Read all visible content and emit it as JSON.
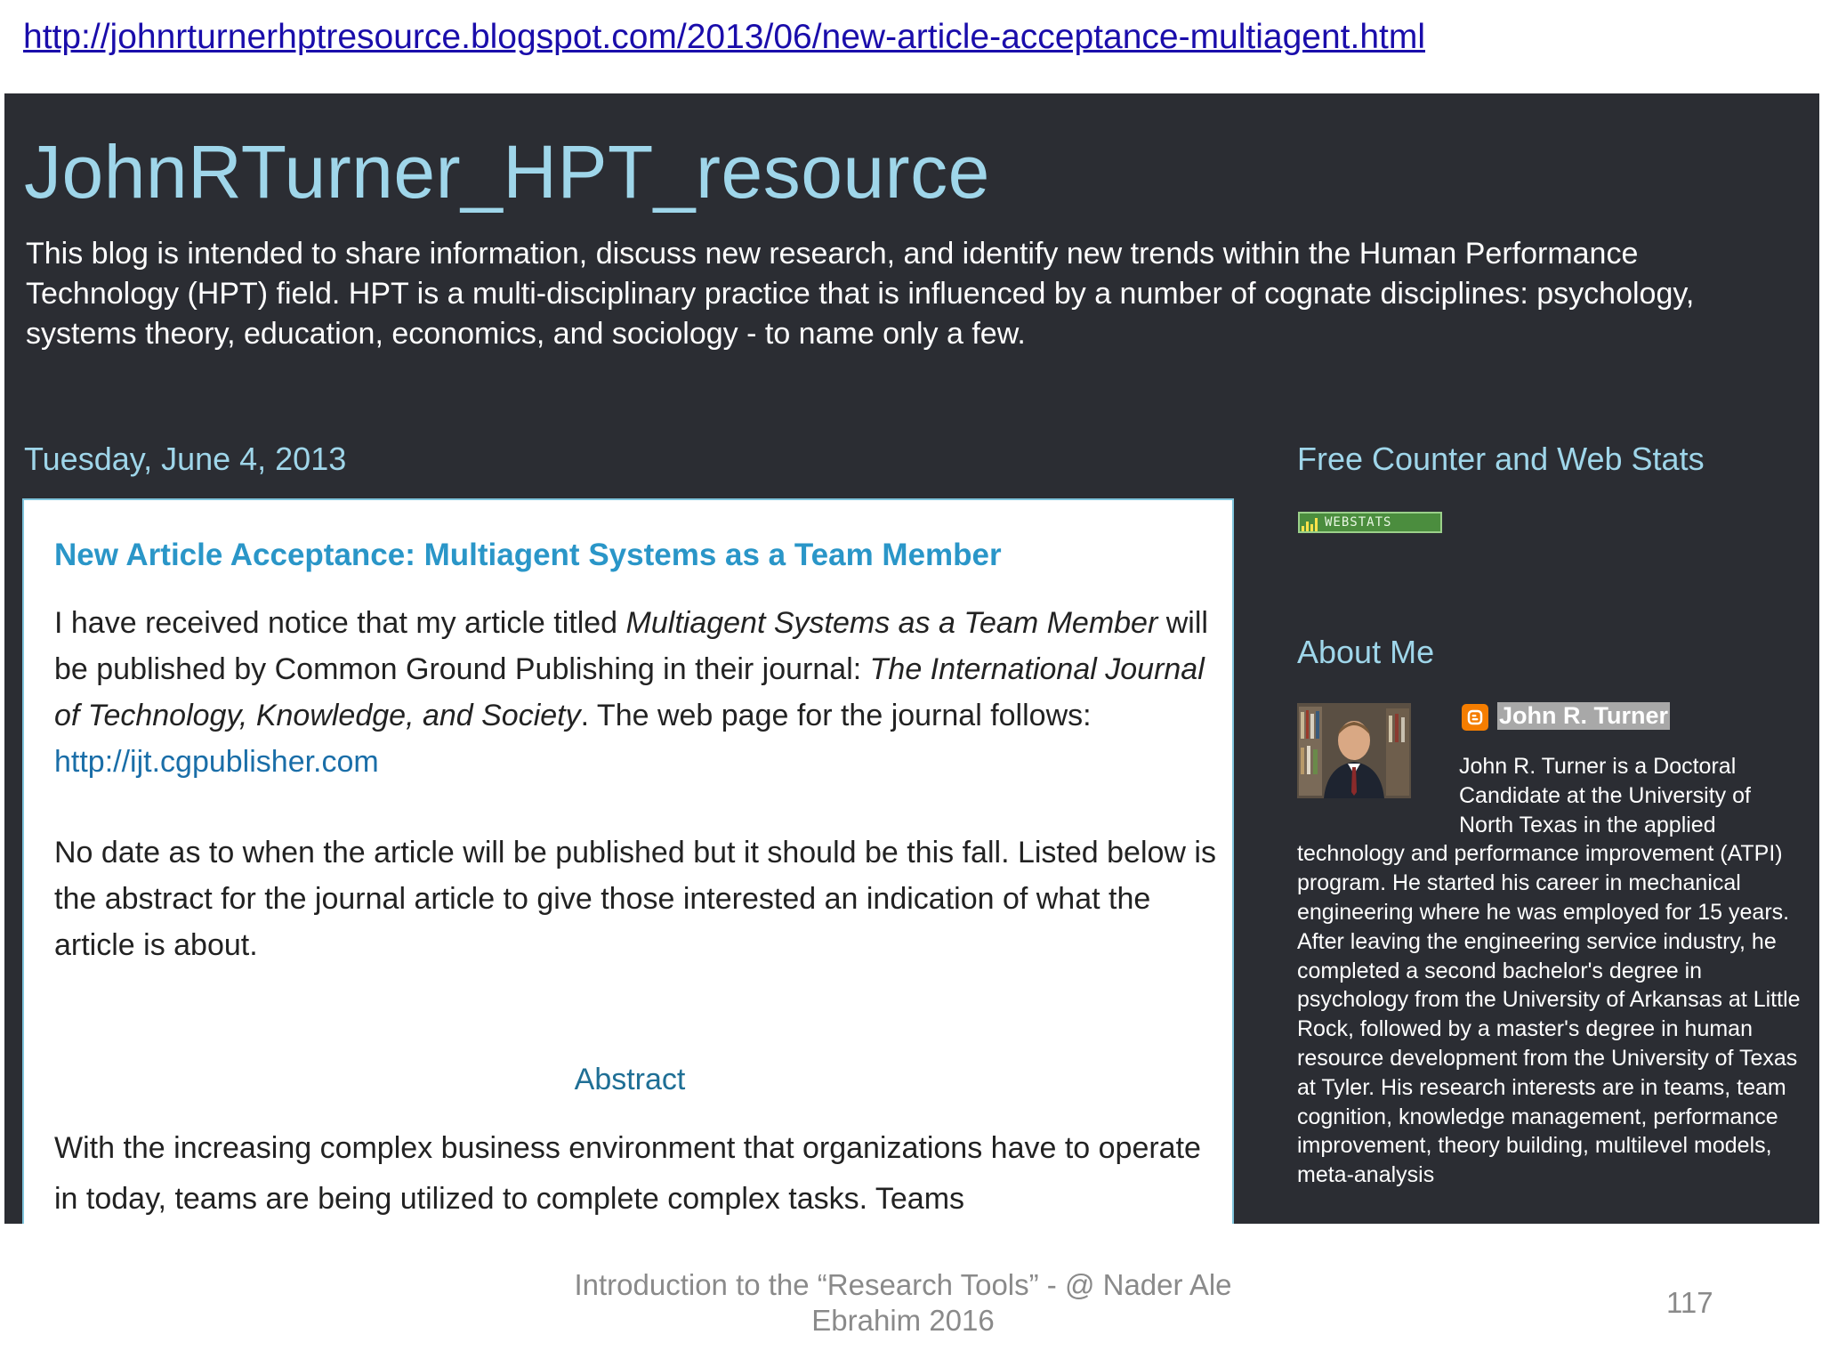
{
  "url": "http://johnrturnerhptresource.blogspot.com/2013/06/new-article-acceptance-multiagent.html",
  "blog": {
    "title": "JohnRTurner_HPT_resource",
    "description": "This blog is intended to share information, discuss new research, and identify new trends within the Human Performance Technology (HPT) field. HPT is a multi-disciplinary practice that is influenced by a number of cognate disciplines: psychology, systems theory, education, economics, and sociology - to name only a few."
  },
  "post": {
    "date": "Tuesday, June 4, 2013",
    "title": "New Article Acceptance: Multiagent Systems as a Team Member",
    "para1": {
      "t1": "I have received notice that my article titled ",
      "t2": "Multiagent Systems as a Team Member",
      "t3": " will be published by Common Ground Publishing in their journal: ",
      "t4": "The International Journal of Technology, Knowledge, and Society",
      "t5": ". The web page for the journal follows: ",
      "link": "http://ijt.cgpublisher.com"
    },
    "para2": "No date as to when the article will be published but it should be this fall. Listed below is the abstract for the journal article to give those interested an indication of what the article is about.",
    "abstract_heading": "Abstract",
    "abstract_text": "With the increasing complex business environment that organizations have to operate in today, teams are being utilized to complete complex tasks.  Teams"
  },
  "sidebar": {
    "counter_heading": "Free Counter and Web Stats",
    "webstats_label": "WEBSTATS",
    "about_heading": "About Me",
    "profile_name": "John R. Turner",
    "profile_bio": "John R. Turner is a Doctoral Candidate at the University of North Texas in the applied technology and performance improvement (ATPI) program. He started his career in mechanical engineering where he was employed for 15 years. After leaving the engineering service industry, he completed a second bachelor's degree in psychology from the University of Arkansas at Little Rock, followed by a master's degree in human resource development from the University of Texas at Tyler. His research interests are in teams, team cognition, knowledge management, performance improvement, theory building, multilevel models, meta-analysis"
  },
  "footer": {
    "caption": "Introduction to the “Research Tools” - @ Nader Ale Ebrahim 2016",
    "page_number": "117"
  }
}
